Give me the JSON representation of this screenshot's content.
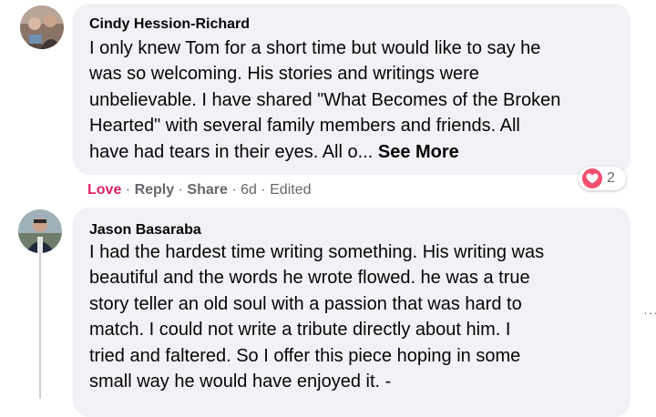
{
  "comments": [
    {
      "author": "Cindy Hession-Richard",
      "lines": [
        "I only knew Tom for a short time but would like to say he",
        "was so welcoming. His stories and writings were",
        "unbelievable. I have shared \"What Becomes of the Broken",
        "Hearted\" with several family members and friends. All",
        "have had tears in their eyes. All o... "
      ],
      "see_more": "See More",
      "actions": {
        "love": "Love",
        "reply": "Reply",
        "share": "Share",
        "time": "6d",
        "edited": "Edited",
        "separator": "·"
      },
      "reactions": {
        "icon": "heart-icon",
        "count": "2",
        "color": "#f0506e"
      }
    },
    {
      "author": "Jason Basaraba",
      "lines": [
        "I had the hardest time writing something. His writing was",
        "beautiful and the words he wrote flowed. he was a true",
        "story teller an old soul with a passion that was hard to",
        "match. I could not write a tribute directly about him. I",
        "tried and faltered. So I offer this piece hoping in some",
        "small way he would have enjoyed it. -"
      ]
    }
  ],
  "colors": {
    "bubble": "#f0f2f5",
    "love": "#e0245e",
    "meta": "#65676b"
  }
}
